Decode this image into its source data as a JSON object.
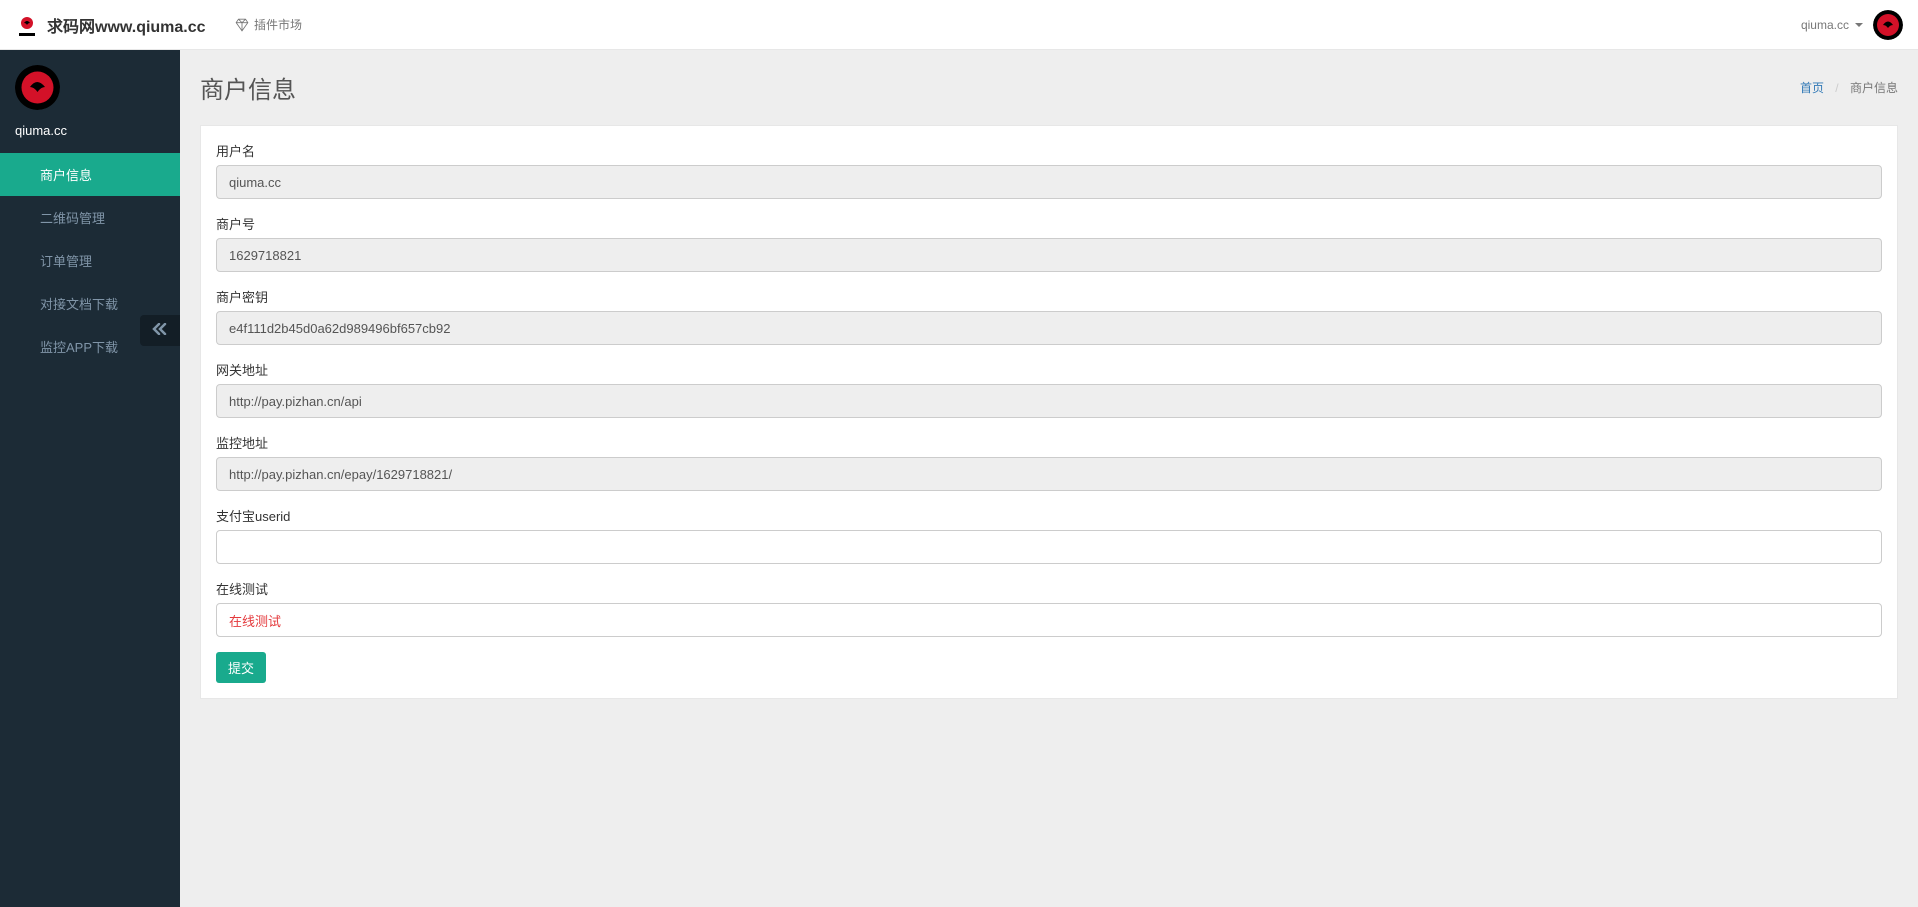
{
  "header": {
    "brand_text": "求码网www.qiuma.cc",
    "plugin_market": "插件市场",
    "user_name": "qiuma.cc"
  },
  "sidebar": {
    "username": "qiuma.cc",
    "menu": [
      {
        "label": "商户信息",
        "active": true
      },
      {
        "label": "二维码管理",
        "active": false
      },
      {
        "label": "订单管理",
        "active": false
      },
      {
        "label": "对接文档下载",
        "active": false
      },
      {
        "label": "监控APP下载",
        "active": false
      }
    ]
  },
  "page": {
    "title": "商户信息",
    "breadcrumb_home": "首页",
    "breadcrumb_current": "商户信息"
  },
  "form": {
    "username_label": "用户名",
    "username_value": "qiuma.cc",
    "merchant_id_label": "商户号",
    "merchant_id_value": "1629718821",
    "merchant_key_label": "商户密钥",
    "merchant_key_value": "e4f111d2b45d0a62d989496bf657cb92",
    "gateway_label": "网关地址",
    "gateway_value": "http://pay.pizhan.cn/api",
    "monitor_label": "监控地址",
    "monitor_value": "http://pay.pizhan.cn/epay/1629718821/",
    "alipay_userid_label": "支付宝userid",
    "alipay_userid_value": "",
    "online_test_label": "在线测试",
    "online_test_link": "在线测试",
    "submit_label": "提交"
  }
}
